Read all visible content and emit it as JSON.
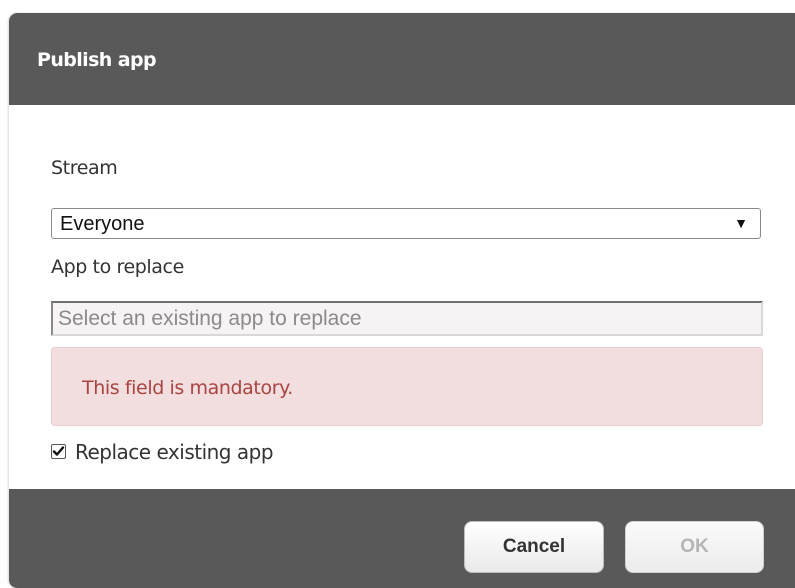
{
  "dialog": {
    "title": "Publish app"
  },
  "form": {
    "stream_label": "Stream",
    "stream_value": "Everyone",
    "app_label": "App to replace",
    "app_placeholder": "Select an existing app to replace",
    "error_message": "This field is mandatory.",
    "replace_label": "Replace existing app",
    "replace_checked": true
  },
  "footer": {
    "cancel_label": "Cancel",
    "ok_label": "OK"
  },
  "icons": {
    "dropdown": "caret-down-icon",
    "check": "checkmark-icon"
  },
  "colors": {
    "header": "#595959",
    "error_bg": "#f2dede",
    "error_text": "#a94442"
  }
}
